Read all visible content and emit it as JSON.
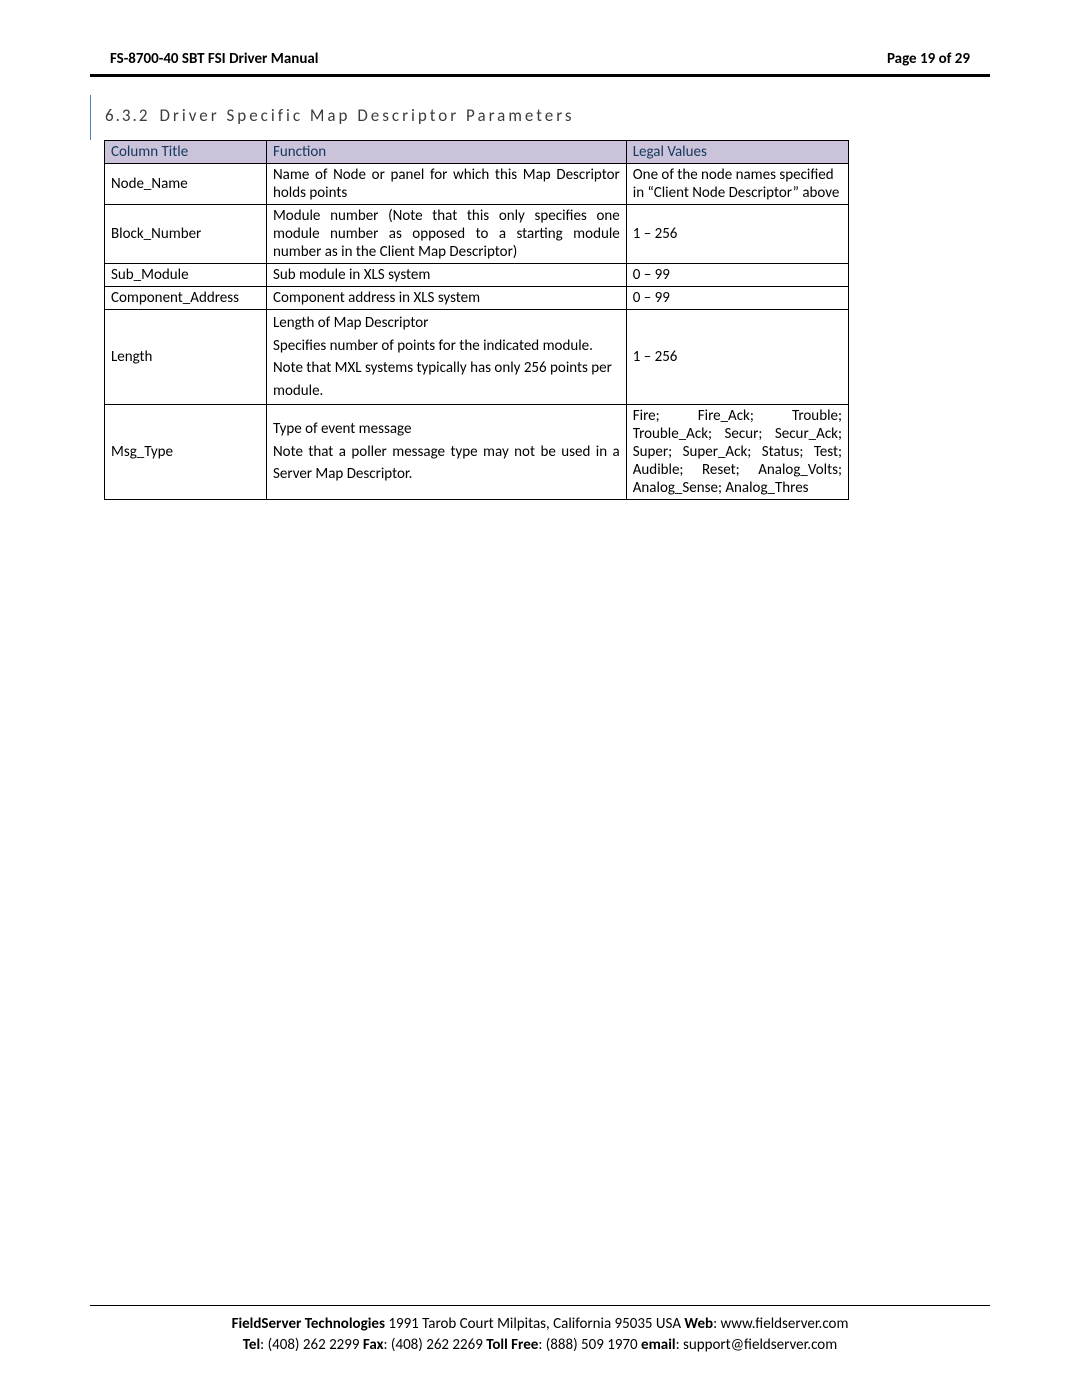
{
  "header": {
    "title": "FS-8700-40 SBT FSI Driver Manual",
    "page_prefix": "Page ",
    "page_current": "19",
    "page_of": " of ",
    "page_total": "29"
  },
  "section": {
    "number": "6.3.2",
    "title": "Driver Specific Map Descriptor Parameters"
  },
  "table": {
    "headers": {
      "col1": "Column Title",
      "col2": "Function",
      "col3": "Legal Values"
    },
    "rows": [
      {
        "title": "Node_Name",
        "function": "Name of Node or panel for which this Map Descriptor holds points",
        "legal": "One of the node names specified in “Client Node Descriptor” above"
      },
      {
        "title": "Block_Number",
        "function": "Module number (Note that this only specifies one module number as opposed to a starting module number as in the Client Map Descriptor)",
        "legal": "1 – 256"
      },
      {
        "title": "Sub_Module",
        "function": "Sub module in XLS system",
        "legal": "0 – 99"
      },
      {
        "title": "Component_Address",
        "function": "Component address in XLS system",
        "legal": "0 – 99"
      },
      {
        "title": "Length",
        "function_lines": [
          "Length of Map Descriptor",
          "Specifies number of points for the indicated module. Note that MXL systems typically has only 256 points per module."
        ],
        "legal": "1 – 256"
      },
      {
        "title": "Msg_Type",
        "function_lines": [
          "Type of event message",
          "Note that a poller message type may not be used in a Server Map Descriptor."
        ],
        "legal": "Fire; Fire_Ack; Trouble; Trouble_Ack; Secur; Secur_Ack; Super; Super_Ack; Status; Test; Audible; Reset; Analog_Volts; Analog_Sense; Analog_Thres"
      }
    ]
  },
  "footer": {
    "company_bold": "FieldServer Technologies",
    "address": " 1991 Tarob Court Milpitas, California 95035 USA   ",
    "web_label": "Web",
    "web_value": ": www.fieldserver.com",
    "tel_label": "Tel",
    "tel_value": ": (408) 262 2299   ",
    "fax_label": "Fax",
    "fax_value": ": (408) 262 2269   ",
    "tollfree_label": "Toll Free",
    "tollfree_value": ": (888) 509 1970   ",
    "email_label": "email",
    "email_value": ": support@fieldserver.com"
  }
}
